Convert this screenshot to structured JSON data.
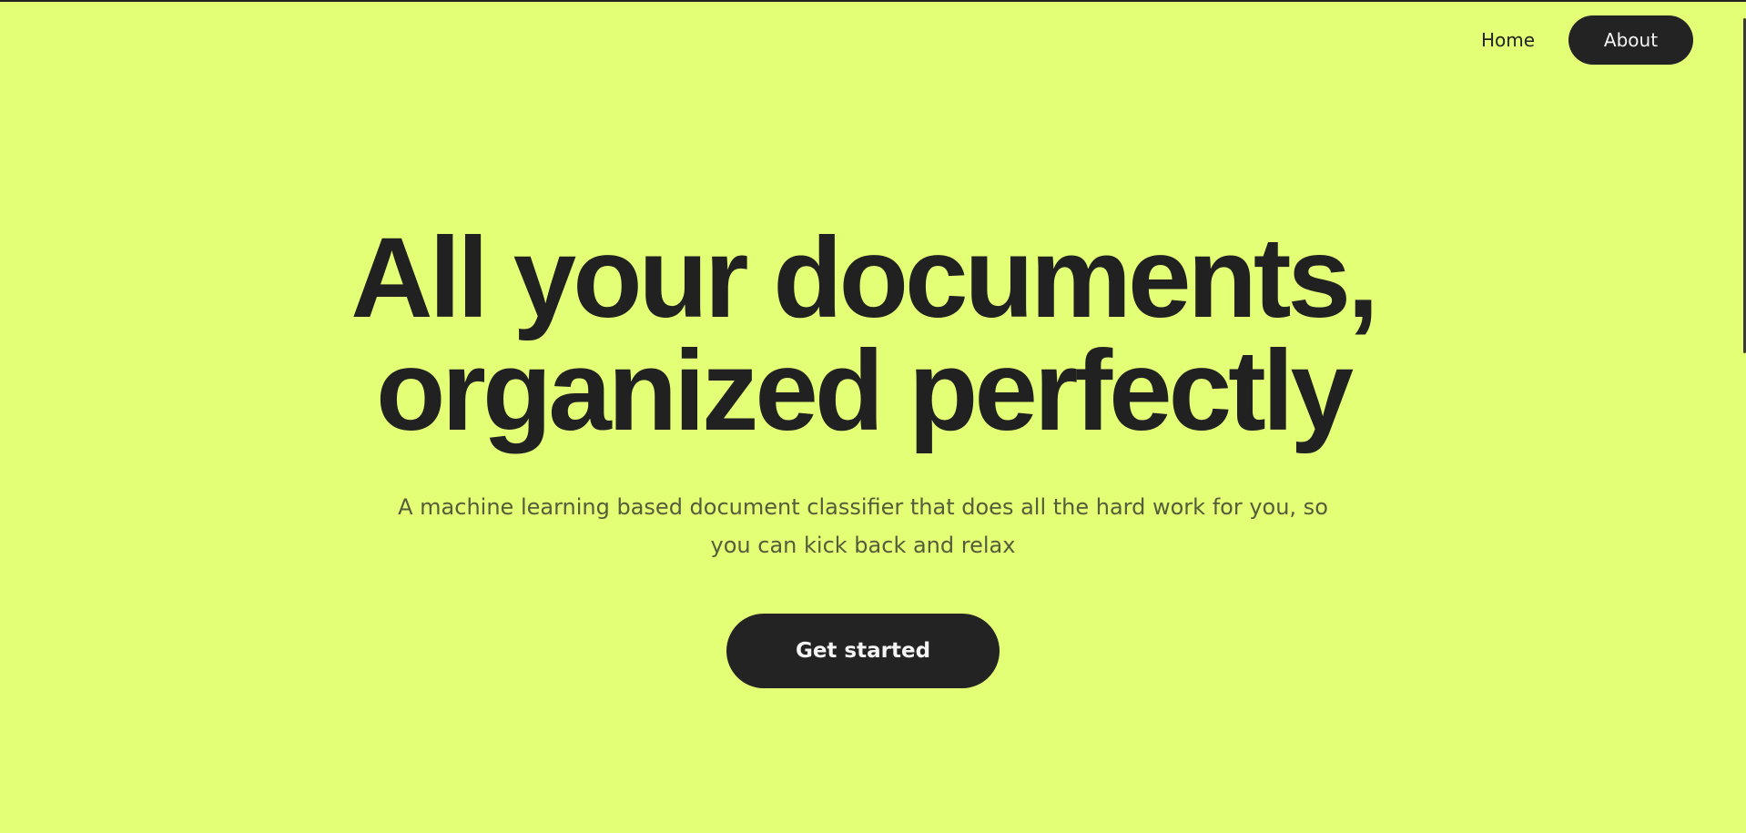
{
  "nav": {
    "home_label": "Home",
    "about_label": "About"
  },
  "hero": {
    "headline_line1": "All your documents,",
    "headline_line2": "organized perfectly",
    "subtitle": "A machine learning based document classifier that does all the hard work for you, so you can kick back and relax",
    "cta_label": "Get started"
  },
  "colors": {
    "background": "#e3ff76",
    "text": "#222222",
    "pill": "#232323",
    "pill_text": "#f4f4f4",
    "subtitle_text": "#555c3a"
  }
}
